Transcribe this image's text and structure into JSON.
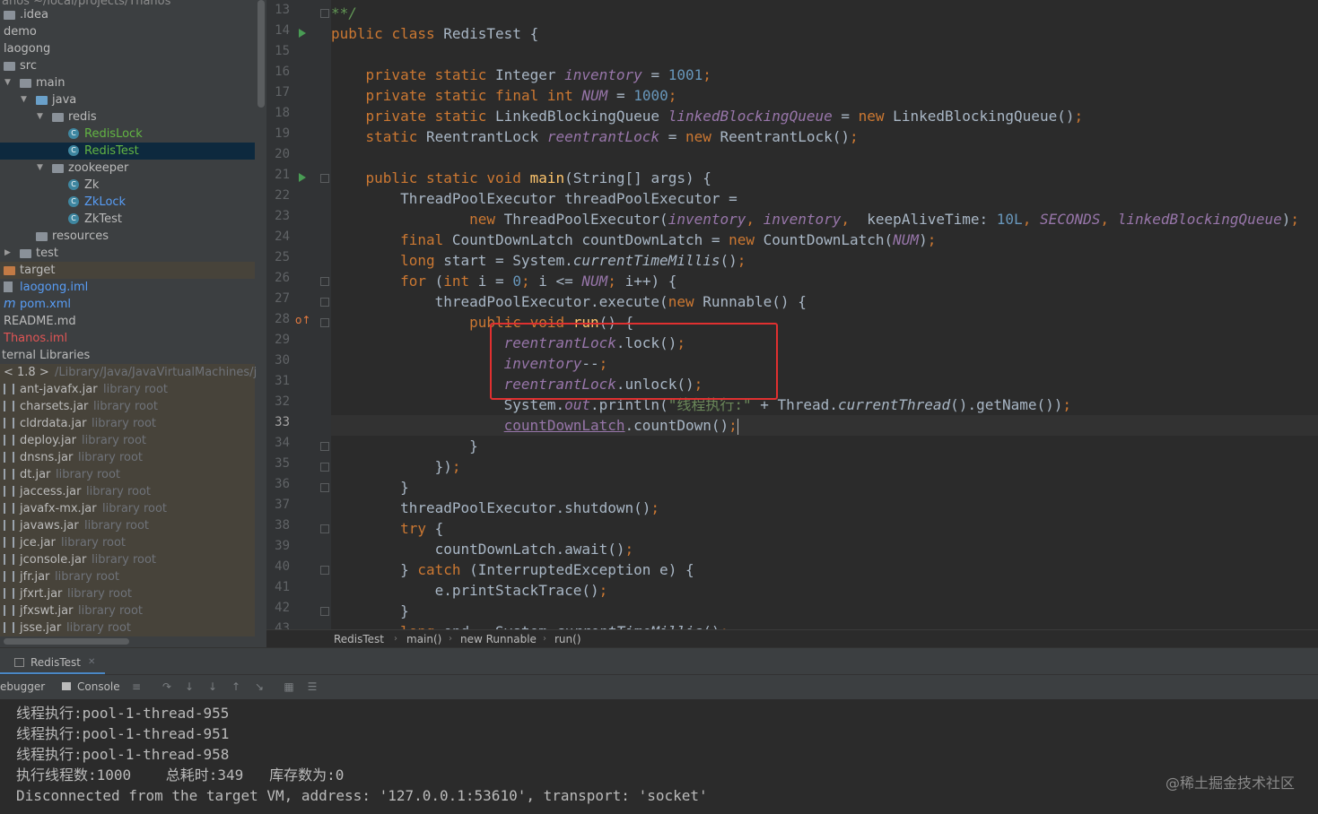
{
  "project_tree": {
    "top_partial": "anos   ~/local/projects/Thanos",
    "items": [
      {
        "label": ".idea",
        "hint": "",
        "color": "#bbbbbb"
      },
      {
        "label": "demo",
        "hint": "",
        "color": "#bbbbbb"
      },
      {
        "label": "laogong",
        "hint": "",
        "color": "#bbbbbb"
      },
      {
        "label": "src",
        "hint": "",
        "color": "#bbbbbb"
      },
      {
        "label": "main",
        "hint": "",
        "color": "#bbbbbb"
      },
      {
        "label": "java",
        "hint": "",
        "color": "#bbbbbb"
      },
      {
        "label": "redis",
        "hint": "",
        "color": "#bbbbbb"
      },
      {
        "label": "RedisLock",
        "hint": "",
        "color": "#62b543"
      },
      {
        "label": "RedisTest",
        "hint": "",
        "color": "#62b543"
      },
      {
        "label": "zookeeper",
        "hint": "",
        "color": "#bbbbbb"
      },
      {
        "label": "Zk",
        "hint": "",
        "color": "#bbbbbb"
      },
      {
        "label": "ZkLock",
        "hint": "",
        "color": "#589df6"
      },
      {
        "label": "ZkTest",
        "hint": "",
        "color": "#bbbbbb"
      },
      {
        "label": "resources",
        "hint": "",
        "color": "#bbbbbb"
      },
      {
        "label": "test",
        "hint": "",
        "color": "#bbbbbb"
      },
      {
        "label": "target",
        "hint": "",
        "color": "#bbbbbb"
      },
      {
        "label": "laogong.iml",
        "hint": "",
        "color": "#589df6"
      },
      {
        "label": "pom.xml",
        "hint": "",
        "color": "#589df6"
      },
      {
        "label": "README.md",
        "hint": "",
        "color": "#bbbbbb"
      },
      {
        "label": "Thanos.iml",
        "hint": "",
        "color": "#e05555"
      },
      {
        "label": "ternal Libraries",
        "hint": "",
        "color": "#bbbbbb"
      },
      {
        "label": "< 1.8 >",
        "hint": "/Library/Java/JavaVirtualMachines/j",
        "color": "#bbbbbb"
      },
      {
        "label": "ant-javafx.jar",
        "hint": "library root",
        "color": "#bbbbbb"
      },
      {
        "label": "charsets.jar",
        "hint": "library root",
        "color": "#bbbbbb"
      },
      {
        "label": "cldrdata.jar",
        "hint": "library root",
        "color": "#bbbbbb"
      },
      {
        "label": "deploy.jar",
        "hint": "library root",
        "color": "#bbbbbb"
      },
      {
        "label": "dnsns.jar",
        "hint": "library root",
        "color": "#bbbbbb"
      },
      {
        "label": "dt.jar",
        "hint": "library root",
        "color": "#bbbbbb"
      },
      {
        "label": "jaccess.jar",
        "hint": "library root",
        "color": "#bbbbbb"
      },
      {
        "label": "javafx-mx.jar",
        "hint": "library root",
        "color": "#bbbbbb"
      },
      {
        "label": "javaws.jar",
        "hint": "library root",
        "color": "#bbbbbb"
      },
      {
        "label": "jce.jar",
        "hint": "library root",
        "color": "#bbbbbb"
      },
      {
        "label": "jconsole.jar",
        "hint": "library root",
        "color": "#bbbbbb"
      },
      {
        "label": "jfr.jar",
        "hint": "library root",
        "color": "#bbbbbb"
      },
      {
        "label": "jfxrt.jar",
        "hint": "library root",
        "color": "#bbbbbb"
      },
      {
        "label": "jfxswt.jar",
        "hint": "library root",
        "color": "#bbbbbb"
      },
      {
        "label": "jsse.jar",
        "hint": "library root",
        "color": "#bbbbbb"
      }
    ]
  },
  "editor": {
    "line_numbers": [
      "13",
      "14",
      "15",
      "16",
      "17",
      "18",
      "19",
      "20",
      "21",
      "22",
      "23",
      "24",
      "25",
      "26",
      "27",
      "28",
      "29",
      "30",
      "31",
      "32",
      "33",
      "34",
      "35",
      "36",
      "37",
      "38",
      "39",
      "40",
      "41",
      "42",
      "43"
    ],
    "current_line": "33",
    "lines": [
      {
        "t": "**/",
        "cls": "cm"
      },
      {
        "t": "public class RedisTest {"
      },
      {
        "t": ""
      },
      {
        "t": "    private static Integer inventory = 1001;"
      },
      {
        "t": "    private static final int NUM = 1000;"
      },
      {
        "t": "    private static LinkedBlockingQueue linkedBlockingQueue = new LinkedBlockingQueue();"
      },
      {
        "t": "    static ReentrantLock reentrantLock = new ReentrantLock();"
      },
      {
        "t": ""
      },
      {
        "t": "    public static void main(String[] args) {"
      },
      {
        "t": "        ThreadPoolExecutor threadPoolExecutor ="
      },
      {
        "t": "                new ThreadPoolExecutor(inventory, inventory,  keepAliveTime: 10L, SECONDS, linkedBlockingQueue);"
      },
      {
        "t": "        final CountDownLatch countDownLatch = new CountDownLatch(NUM);"
      },
      {
        "t": "        long start = System.currentTimeMillis();"
      },
      {
        "t": "        for (int i = 0; i <= NUM; i++) {"
      },
      {
        "t": "            threadPoolExecutor.execute(new Runnable() {"
      },
      {
        "t": "                public void run() {"
      },
      {
        "t": "                    reentrantLock.lock();"
      },
      {
        "t": "                    inventory--;"
      },
      {
        "t": "                    reentrantLock.unlock();"
      },
      {
        "t": "                    System.out.println(\"线程执行:\" + Thread.currentThread().getName());"
      },
      {
        "t": "                    countDownLatch.countDown();"
      },
      {
        "t": "                }"
      },
      {
        "t": "            });"
      },
      {
        "t": "        }"
      },
      {
        "t": "        threadPoolExecutor.shutdown();"
      },
      {
        "t": "        try {"
      },
      {
        "t": "            countDownLatch.await();"
      },
      {
        "t": "        } catch (InterruptedException e) {"
      },
      {
        "t": "            e.printStackTrace();"
      },
      {
        "t": "        }"
      },
      {
        "t": "        long end = System.currentTimeMillis();"
      }
    ]
  },
  "breadcrumb": [
    "RedisTest",
    "main()",
    "new Runnable",
    "run()"
  ],
  "run_panel": {
    "tab_label": "RedisTest",
    "debugger_label": "ebugger",
    "console_label": "Console"
  },
  "console_lines": [
    "线程执行:pool-1-thread-955",
    "线程执行:pool-1-thread-951",
    "线程执行:pool-1-thread-958",
    "执行线程数:1000    总耗时:349   库存数为:0",
    "Disconnected from the target VM, address: '127.0.0.1:53610', transport: 'socket'"
  ],
  "watermark": "@稀土掘金技术社区",
  "colors": {
    "keyword": "#cc7832",
    "field": "#9876aa",
    "number": "#6897bb",
    "string": "#6a8759",
    "annotation_box": "#e03030",
    "selection": "#0d293e"
  }
}
